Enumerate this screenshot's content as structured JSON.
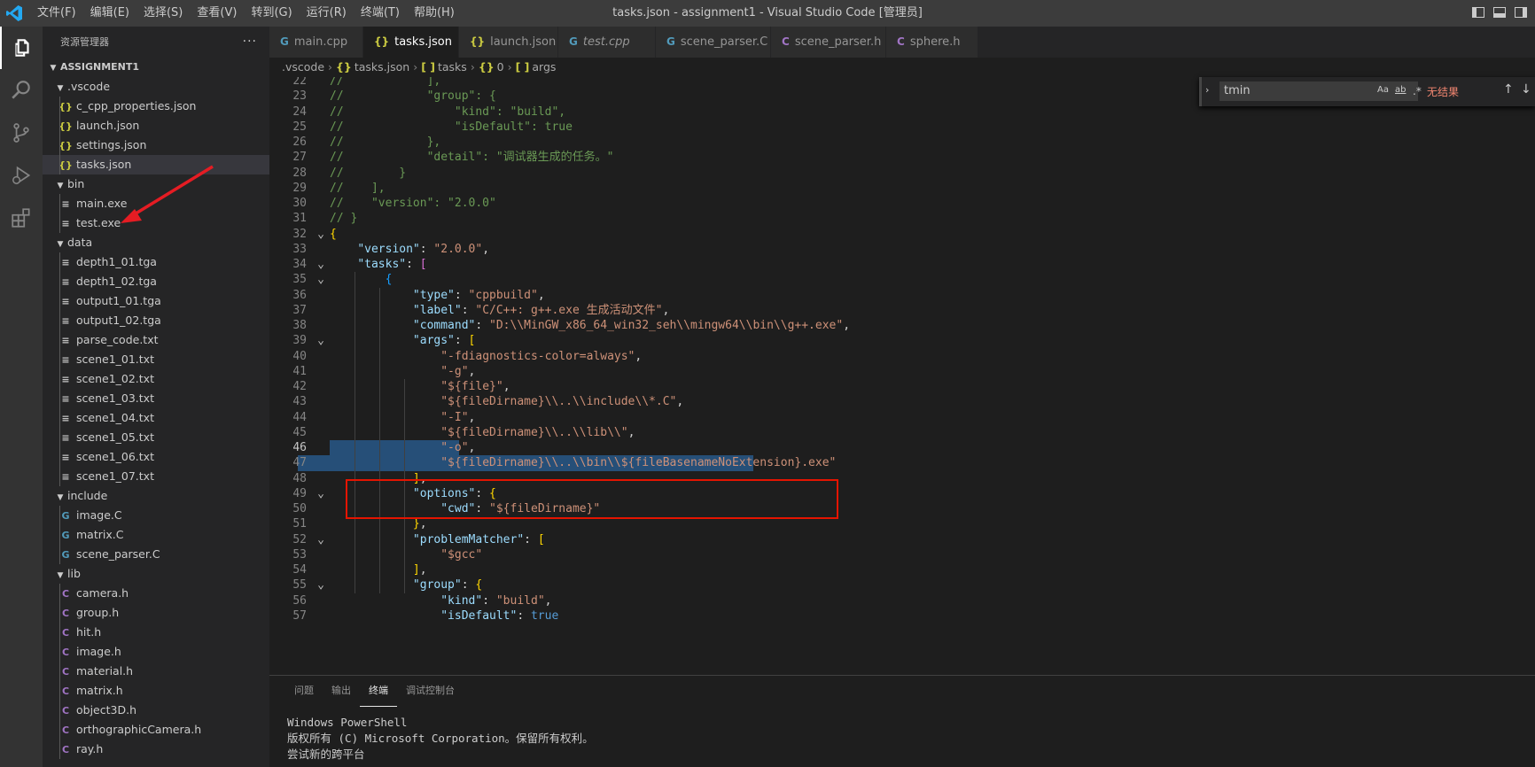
{
  "titlebar": {
    "title": "tasks.json - assignment1 - Visual Studio Code [管理员]",
    "menu": [
      "文件(F)",
      "编辑(E)",
      "选择(S)",
      "查看(V)",
      "转到(G)",
      "运行(R)",
      "终端(T)",
      "帮助(H)"
    ]
  },
  "sidebar": {
    "header": "资源管理器",
    "more": "···",
    "section": "ASSIGNMENT1",
    "tree": [
      {
        "label": ".vscode",
        "type": "folder",
        "depth": 1,
        "open": true
      },
      {
        "label": "c_cpp_properties.json",
        "type": "json",
        "depth": 2
      },
      {
        "label": "launch.json",
        "type": "json",
        "depth": 2
      },
      {
        "label": "settings.json",
        "type": "json",
        "depth": 2
      },
      {
        "label": "tasks.json",
        "type": "json",
        "depth": 2,
        "selected": true
      },
      {
        "label": "bin",
        "type": "folder",
        "depth": 1,
        "open": true
      },
      {
        "label": "main.exe",
        "type": "file",
        "depth": 2
      },
      {
        "label": "test.exe",
        "type": "file",
        "depth": 2
      },
      {
        "label": "data",
        "type": "folder",
        "depth": 1,
        "open": true
      },
      {
        "label": "depth1_01.tga",
        "type": "file",
        "depth": 2
      },
      {
        "label": "depth1_02.tga",
        "type": "file",
        "depth": 2
      },
      {
        "label": "output1_01.tga",
        "type": "file",
        "depth": 2
      },
      {
        "label": "output1_02.tga",
        "type": "file",
        "depth": 2
      },
      {
        "label": "parse_code.txt",
        "type": "file",
        "depth": 2
      },
      {
        "label": "scene1_01.txt",
        "type": "file",
        "depth": 2
      },
      {
        "label": "scene1_02.txt",
        "type": "file",
        "depth": 2
      },
      {
        "label": "scene1_03.txt",
        "type": "file",
        "depth": 2
      },
      {
        "label": "scene1_04.txt",
        "type": "file",
        "depth": 2
      },
      {
        "label": "scene1_05.txt",
        "type": "file",
        "depth": 2
      },
      {
        "label": "scene1_06.txt",
        "type": "file",
        "depth": 2
      },
      {
        "label": "scene1_07.txt",
        "type": "file",
        "depth": 2
      },
      {
        "label": "include",
        "type": "folder",
        "depth": 1,
        "open": true
      },
      {
        "label": "image.C",
        "type": "cfile",
        "depth": 2
      },
      {
        "label": "matrix.C",
        "type": "cfile",
        "depth": 2
      },
      {
        "label": "scene_parser.C",
        "type": "cfile",
        "depth": 2
      },
      {
        "label": "lib",
        "type": "folder",
        "depth": 1,
        "open": true
      },
      {
        "label": "camera.h",
        "type": "hfile",
        "depth": 2
      },
      {
        "label": "group.h",
        "type": "hfile",
        "depth": 2
      },
      {
        "label": "hit.h",
        "type": "hfile",
        "depth": 2
      },
      {
        "label": "image.h",
        "type": "hfile",
        "depth": 2
      },
      {
        "label": "material.h",
        "type": "hfile",
        "depth": 2
      },
      {
        "label": "matrix.h",
        "type": "hfile",
        "depth": 2
      },
      {
        "label": "object3D.h",
        "type": "hfile",
        "depth": 2
      },
      {
        "label": "orthographicCamera.h",
        "type": "hfile",
        "depth": 2
      },
      {
        "label": "ray.h",
        "type": "hfile",
        "depth": 2
      }
    ]
  },
  "tabs": [
    {
      "label": "main.cpp",
      "icon": "G",
      "icon_color": "#519aba"
    },
    {
      "label": "tasks.json",
      "icon": "{}",
      "icon_color": "#cbcb41",
      "active": true,
      "close": "×"
    },
    {
      "label": "launch.json",
      "icon": "{}",
      "icon_color": "#cbcb41"
    },
    {
      "label": "test.cpp",
      "icon": "G",
      "icon_color": "#519aba",
      "italic": true
    },
    {
      "label": "scene_parser.C",
      "icon": "G",
      "icon_color": "#519aba"
    },
    {
      "label": "scene_parser.h",
      "icon": "C",
      "icon_color": "#a074c4"
    },
    {
      "label": "sphere.h",
      "icon": "C",
      "icon_color": "#a074c4"
    }
  ],
  "breadcrumb": [
    {
      "icon": "",
      "label": ".vscode"
    },
    {
      "icon": "{}",
      "label": "tasks.json"
    },
    {
      "icon": "[ ]",
      "label": "tasks"
    },
    {
      "icon": "{}",
      "label": "0"
    },
    {
      "icon": "[ ]",
      "label": "args"
    }
  ],
  "find": {
    "value": "tmin",
    "options": [
      "Aa",
      "ab",
      ".*"
    ],
    "result": "无结果",
    "up": "↑",
    "down": "↓",
    "menu": "≡"
  },
  "editor": {
    "current_line": 46,
    "lines": [
      {
        "n": 22,
        "fold": "",
        "parts": [
          [
            "c-comment",
            "//            ],"
          ]
        ]
      },
      {
        "n": 23,
        "fold": "",
        "parts": [
          [
            "c-comment",
            "//            \"group\": {"
          ]
        ]
      },
      {
        "n": 24,
        "fold": "",
        "parts": [
          [
            "c-comment",
            "//                \"kind\": \"build\","
          ]
        ]
      },
      {
        "n": 25,
        "fold": "",
        "parts": [
          [
            "c-comment",
            "//                \"isDefault\": true"
          ]
        ]
      },
      {
        "n": 26,
        "fold": "",
        "parts": [
          [
            "c-comment",
            "//            },"
          ]
        ]
      },
      {
        "n": 27,
        "fold": "",
        "parts": [
          [
            "c-comment",
            "//            \"detail\": \"调试器生成的任务。\""
          ]
        ]
      },
      {
        "n": 28,
        "fold": "",
        "parts": [
          [
            "c-comment",
            "//        }"
          ]
        ]
      },
      {
        "n": 29,
        "fold": "",
        "parts": [
          [
            "c-comment",
            "//    ],"
          ]
        ]
      },
      {
        "n": 30,
        "fold": "",
        "parts": [
          [
            "c-comment",
            "//    \"version\": \"2.0.0\""
          ]
        ]
      },
      {
        "n": 31,
        "fold": "",
        "parts": [
          [
            "c-comment",
            "// }"
          ]
        ]
      },
      {
        "n": 32,
        "fold": "v",
        "parts": [
          [
            "c-brace",
            "{"
          ]
        ]
      },
      {
        "n": 33,
        "fold": "",
        "parts": [
          [
            "",
            "    "
          ],
          [
            "c-key",
            "\"version\""
          ],
          [
            "",
            ": "
          ],
          [
            "c-str",
            "\"2.0.0\""
          ],
          [
            "",
            ","
          ]
        ]
      },
      {
        "n": 34,
        "fold": "v",
        "parts": [
          [
            "",
            "    "
          ],
          [
            "c-key",
            "\"tasks\""
          ],
          [
            "",
            ": "
          ],
          [
            "c-bracket",
            "["
          ]
        ]
      },
      {
        "n": 35,
        "fold": "v",
        "parts": [
          [
            "",
            "        "
          ],
          [
            "c-brace2",
            "{"
          ]
        ]
      },
      {
        "n": 36,
        "fold": "",
        "parts": [
          [
            "",
            "            "
          ],
          [
            "c-key",
            "\"type\""
          ],
          [
            "",
            ": "
          ],
          [
            "c-str",
            "\"cppbuild\""
          ],
          [
            "",
            ","
          ]
        ]
      },
      {
        "n": 37,
        "fold": "",
        "parts": [
          [
            "",
            "            "
          ],
          [
            "c-key",
            "\"label\""
          ],
          [
            "",
            ": "
          ],
          [
            "c-str",
            "\"C/C++: g++.exe 生成活动文件\""
          ],
          [
            "",
            ","
          ]
        ]
      },
      {
        "n": 38,
        "fold": "",
        "parts": [
          [
            "",
            "            "
          ],
          [
            "c-key",
            "\"command\""
          ],
          [
            "",
            ": "
          ],
          [
            "c-str",
            "\"D:\\\\MinGW_x86_64_win32_seh\\\\mingw64\\\\bin\\\\g++.exe\""
          ],
          [
            "",
            ","
          ]
        ]
      },
      {
        "n": 39,
        "fold": "v",
        "parts": [
          [
            "",
            "            "
          ],
          [
            "c-key",
            "\"args\""
          ],
          [
            "",
            ": "
          ],
          [
            "c-brace",
            "["
          ]
        ]
      },
      {
        "n": 40,
        "fold": "",
        "parts": [
          [
            "",
            "                "
          ],
          [
            "c-str",
            "\"-fdiagnostics-color=always\""
          ],
          [
            "",
            ","
          ]
        ]
      },
      {
        "n": 41,
        "fold": "",
        "parts": [
          [
            "",
            "                "
          ],
          [
            "c-str",
            "\"-g\""
          ],
          [
            "",
            ","
          ]
        ]
      },
      {
        "n": 42,
        "fold": "",
        "parts": [
          [
            "",
            "                "
          ],
          [
            "c-str",
            "\"${file}\""
          ],
          [
            "",
            ","
          ]
        ]
      },
      {
        "n": 43,
        "fold": "",
        "parts": [
          [
            "",
            "                "
          ],
          [
            "c-str",
            "\"${fileDirname}\\\\..\\\\include\\\\*.C\""
          ],
          [
            "",
            ","
          ]
        ]
      },
      {
        "n": 44,
        "fold": "",
        "parts": [
          [
            "",
            "                "
          ],
          [
            "c-str",
            "\"-I\""
          ],
          [
            "",
            ","
          ]
        ]
      },
      {
        "n": 45,
        "fold": "",
        "parts": [
          [
            "",
            "                "
          ],
          [
            "c-str",
            "\"${fileDirname}\\\\..\\\\lib\\\\\""
          ],
          [
            "",
            ","
          ]
        ]
      },
      {
        "n": 46,
        "fold": "",
        "parts": [
          [
            "",
            "                "
          ],
          [
            "c-str",
            "\"-o\""
          ],
          [
            "",
            ","
          ]
        ]
      },
      {
        "n": 47,
        "fold": "",
        "parts": [
          [
            "",
            "                "
          ],
          [
            "c-str",
            "\"${fileDirname}\\\\..\\\\bin\\\\${fileBasenameNoExtension}.exe\""
          ]
        ]
      },
      {
        "n": 48,
        "fold": "",
        "parts": [
          [
            "",
            "            "
          ],
          [
            "c-brace",
            "]"
          ],
          [
            "",
            ","
          ]
        ]
      },
      {
        "n": 49,
        "fold": "v",
        "parts": [
          [
            "",
            "            "
          ],
          [
            "c-key",
            "\"options\""
          ],
          [
            "",
            ": "
          ],
          [
            "c-brace",
            "{"
          ]
        ]
      },
      {
        "n": 50,
        "fold": "",
        "parts": [
          [
            "",
            "                "
          ],
          [
            "c-key",
            "\"cwd\""
          ],
          [
            "",
            ": "
          ],
          [
            "c-str",
            "\"${fileDirname}\""
          ]
        ]
      },
      {
        "n": 51,
        "fold": "",
        "parts": [
          [
            "",
            "            "
          ],
          [
            "c-brace",
            "}"
          ],
          [
            "",
            ","
          ]
        ]
      },
      {
        "n": 52,
        "fold": "v",
        "parts": [
          [
            "",
            "            "
          ],
          [
            "c-key",
            "\"problemMatcher\""
          ],
          [
            "",
            ": "
          ],
          [
            "c-brace",
            "["
          ]
        ]
      },
      {
        "n": 53,
        "fold": "",
        "parts": [
          [
            "",
            "                "
          ],
          [
            "c-str",
            "\"$gcc\""
          ]
        ]
      },
      {
        "n": 54,
        "fold": "",
        "parts": [
          [
            "",
            "            "
          ],
          [
            "c-brace",
            "]"
          ],
          [
            "",
            ","
          ]
        ]
      },
      {
        "n": 55,
        "fold": "v",
        "parts": [
          [
            "",
            "            "
          ],
          [
            "c-key",
            "\"group\""
          ],
          [
            "",
            ": "
          ],
          [
            "c-brace",
            "{"
          ]
        ]
      },
      {
        "n": 56,
        "fold": "",
        "parts": [
          [
            "",
            "                "
          ],
          [
            "c-key",
            "\"kind\""
          ],
          [
            "",
            ": "
          ],
          [
            "c-str",
            "\"build\""
          ],
          [
            "",
            ","
          ]
        ]
      },
      {
        "n": 57,
        "fold": "",
        "parts": [
          [
            "",
            "                "
          ],
          [
            "c-key",
            "\"isDefault\""
          ],
          [
            "",
            ": "
          ],
          [
            "c-bool",
            "true"
          ]
        ]
      }
    ]
  },
  "panel": {
    "tabs": [
      "问题",
      "输出",
      "终端",
      "调试控制台"
    ],
    "active_tab": "终端",
    "terminal_lines": [
      "Windows PowerShell",
      "版权所有 (C) Microsoft Corporation。保留所有权利。",
      "尝试新的跨平台"
    ]
  }
}
